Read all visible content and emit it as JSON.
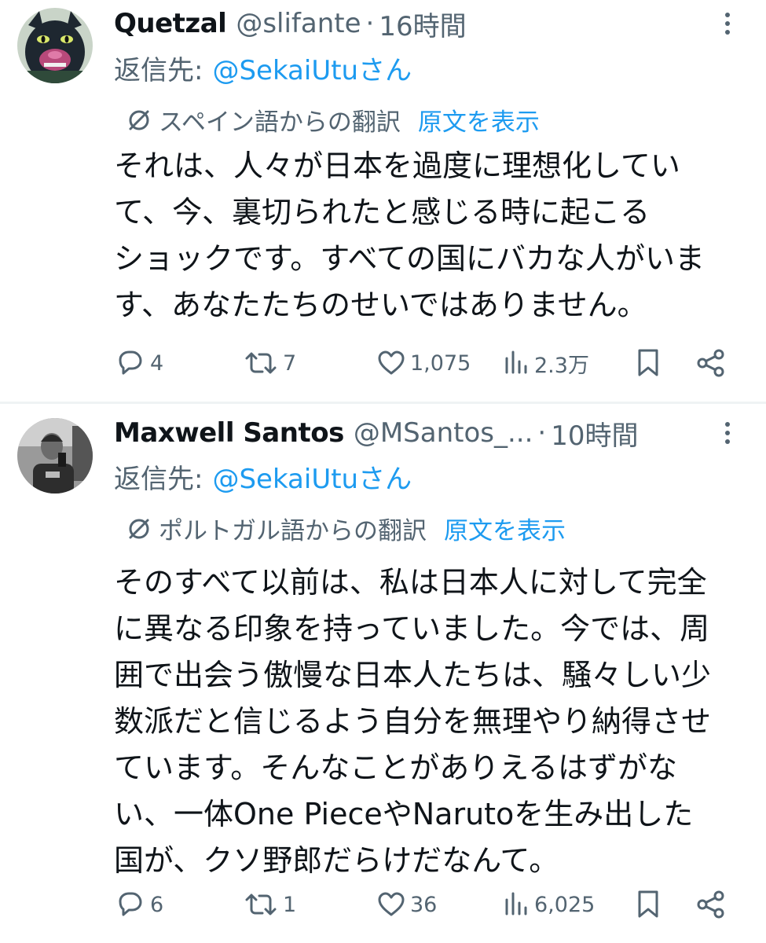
{
  "tweets": [
    {
      "name": "Quetzal",
      "handle": "@slifante",
      "separator": "·",
      "time": "16時間",
      "reply_prefix": "返信先:",
      "reply_mention": "@SekaiUtuさん",
      "translation_label": "スペイン語からの翻訳",
      "show_original": "原文を表示",
      "body_lines": [
        "それは、人々が日本を過度に理想化してい",
        "て、今、裏切られたと感じる時に起こる",
        "ショックです。すべての国にバカな人がいま",
        "す、あなたたちのせいではありません。"
      ],
      "stats": {
        "replies": "4",
        "retweets": "7",
        "likes": "1,075",
        "views": "2.3万"
      },
      "icons": {
        "avatar": "panther-avatar",
        "reply": "reply-icon",
        "retweet": "retweet-icon",
        "like": "heart-icon",
        "views": "views-icon",
        "bookmark": "bookmark-icon",
        "share": "share-icon",
        "more": "more-icon"
      }
    },
    {
      "name": "Maxwell Santos",
      "handle": "@MSantos_...",
      "separator": "·",
      "time": "10時間",
      "reply_prefix": "返信先:",
      "reply_mention": "@SekaiUtuさん",
      "translation_label": "ポルトガル語からの翻訳",
      "show_original": "原文を表示",
      "body_lines": [
        "そのすべて以前は、私は日本人に対して完全",
        "に異なる印象を持っていました。今では、周",
        "囲で出会う傲慢な日本人たちは、騒々しい少",
        "数派だと信じるよう自分を無理やり納得させ",
        "ています。そんなことがありえるはずがな",
        "い、一体One PieceやNarutoを生み出した",
        "国が、クソ野郎だらけだなんて。"
      ],
      "stats": {
        "replies": "6",
        "retweets": "1",
        "likes": "36",
        "views": "6,025"
      },
      "icons": {
        "avatar": "person-photo-avatar",
        "reply": "reply-icon",
        "retweet": "retweet-icon",
        "like": "heart-icon",
        "views": "views-icon",
        "bookmark": "bookmark-icon",
        "share": "share-icon",
        "more": "more-icon"
      }
    }
  ],
  "colors": {
    "text": "#0f1419",
    "secondary": "#536471",
    "accent": "#1d9bf0",
    "divider": "#eff3f4"
  }
}
